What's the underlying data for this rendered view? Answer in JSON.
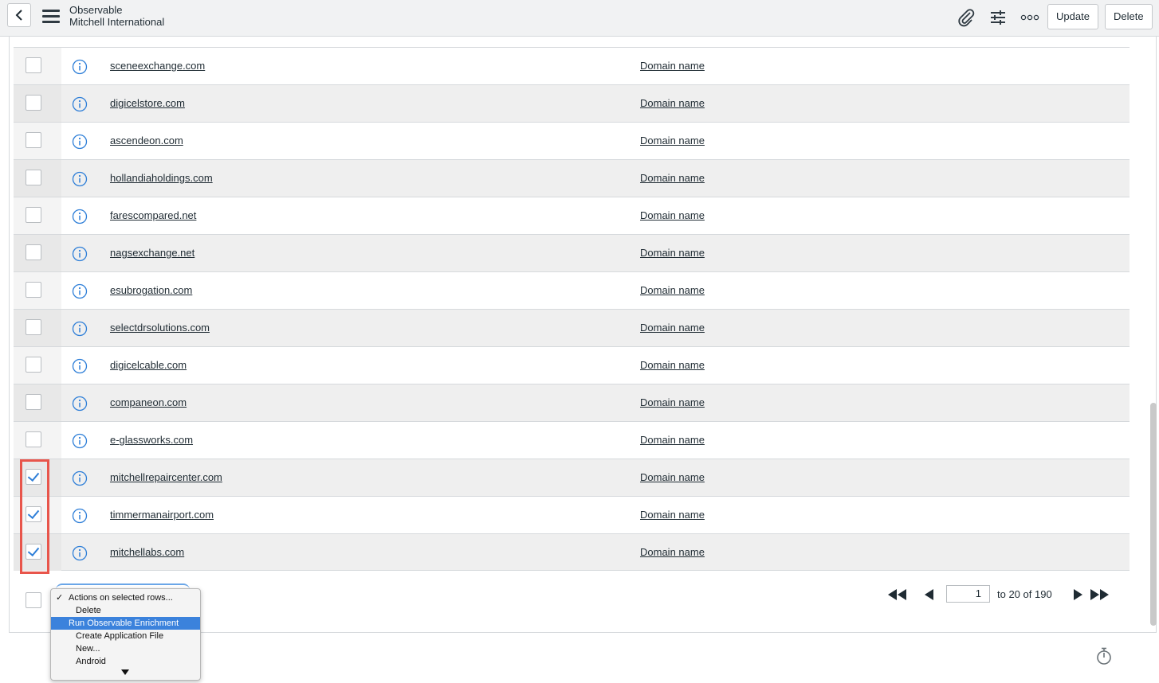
{
  "header": {
    "title": "Observable",
    "subtitle": "Mitchell International",
    "update_label": "Update",
    "delete_label": "Delete"
  },
  "rows": [
    {
      "domain": "sceneexchange.com",
      "type": "Domain name",
      "checked": false
    },
    {
      "domain": "digicelstore.com",
      "type": "Domain name",
      "checked": false
    },
    {
      "domain": "ascendeon.com",
      "type": "Domain name",
      "checked": false
    },
    {
      "domain": "hollandiaholdings.com",
      "type": "Domain name",
      "checked": false
    },
    {
      "domain": "farescompared.net",
      "type": "Domain name",
      "checked": false
    },
    {
      "domain": "nagsexchange.net",
      "type": "Domain name",
      "checked": false
    },
    {
      "domain": "esubrogation.com",
      "type": "Domain name",
      "checked": false
    },
    {
      "domain": "selectdrsolutions.com",
      "type": "Domain name",
      "checked": false
    },
    {
      "domain": "digicelcable.com",
      "type": "Domain name",
      "checked": false
    },
    {
      "domain": "companeon.com",
      "type": "Domain name",
      "checked": false
    },
    {
      "domain": "e-glassworks.com",
      "type": "Domain name",
      "checked": false
    },
    {
      "domain": "mitchellrepaircenter.com",
      "type": "Domain name",
      "checked": true
    },
    {
      "domain": "timmermanairport.com",
      "type": "Domain name",
      "checked": true
    },
    {
      "domain": "mitchellabs.com",
      "type": "Domain name",
      "checked": true
    }
  ],
  "actions_menu": {
    "options": [
      "Actions on selected rows...",
      "Delete",
      "Run Observable Enrichment",
      "Create Application File",
      "New...",
      "Android"
    ],
    "checked_option": "Actions on selected rows...",
    "highlighted_option": "Run Observable Enrichment"
  },
  "pagination": {
    "page_value": "1",
    "range_text": "to 20 of 190"
  },
  "colors": {
    "highlight_border": "#e8554b",
    "checkbox_check": "#2f7fd8",
    "menu_highlight": "#3b82dc"
  }
}
